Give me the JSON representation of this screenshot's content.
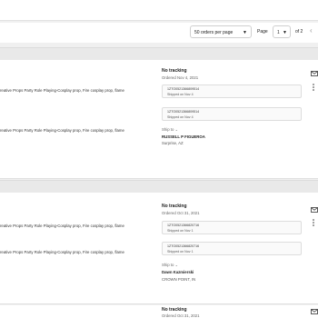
{
  "pagination": {
    "per_page": "50 orders per page",
    "page_label": "Page",
    "current_page": "1",
    "of_pages": "of 2"
  },
  "orders": [
    {
      "description_1": "reative Props Party Role Playing-Cosplay prop, Fire cosplay prop, flame",
      "description_2": "reative Props Party Role Playing-Cosplay prop, Fire cosplay prop, flame",
      "tracking_status": "No tracking",
      "ordered_date": "Ordered Nov 4, 2021",
      "shipments": [
        {
          "tracking_number": "1ZTO0521366809514",
          "shipped": "Shipped on Nov 4"
        },
        {
          "tracking_number": "1ZTO0521366809514",
          "shipped": "Shipped on Nov 4"
        }
      ],
      "ship_to_label": "Ship to",
      "recipient": "RUSSELL P FIGUEROA",
      "city": "Surprise, AZ"
    },
    {
      "description_1": "reative Props Party Role Playing-Cosplay prop, Fire cosplay prop, flame",
      "description_2": "reative Props Party Role Playing-Cosplay prop, Fire cosplay prop, flame",
      "tracking_status": "No tracking",
      "ordered_date": "Ordered Oct 31, 2021",
      "shipments": [
        {
          "tracking_number": "1ZTO0521366820716",
          "shipped": "Shipped on Nov 1"
        },
        {
          "tracking_number": "1ZTO0521366820716",
          "shipped": "Shipped on Nov 1"
        }
      ],
      "ship_to_label": "Ship to",
      "recipient": "Dawn Kazmierski",
      "city": "CROWN POINT, IN"
    },
    {
      "tracking_status": "No tracking",
      "ordered_date": "Ordered Oct 31, 2021"
    }
  ]
}
